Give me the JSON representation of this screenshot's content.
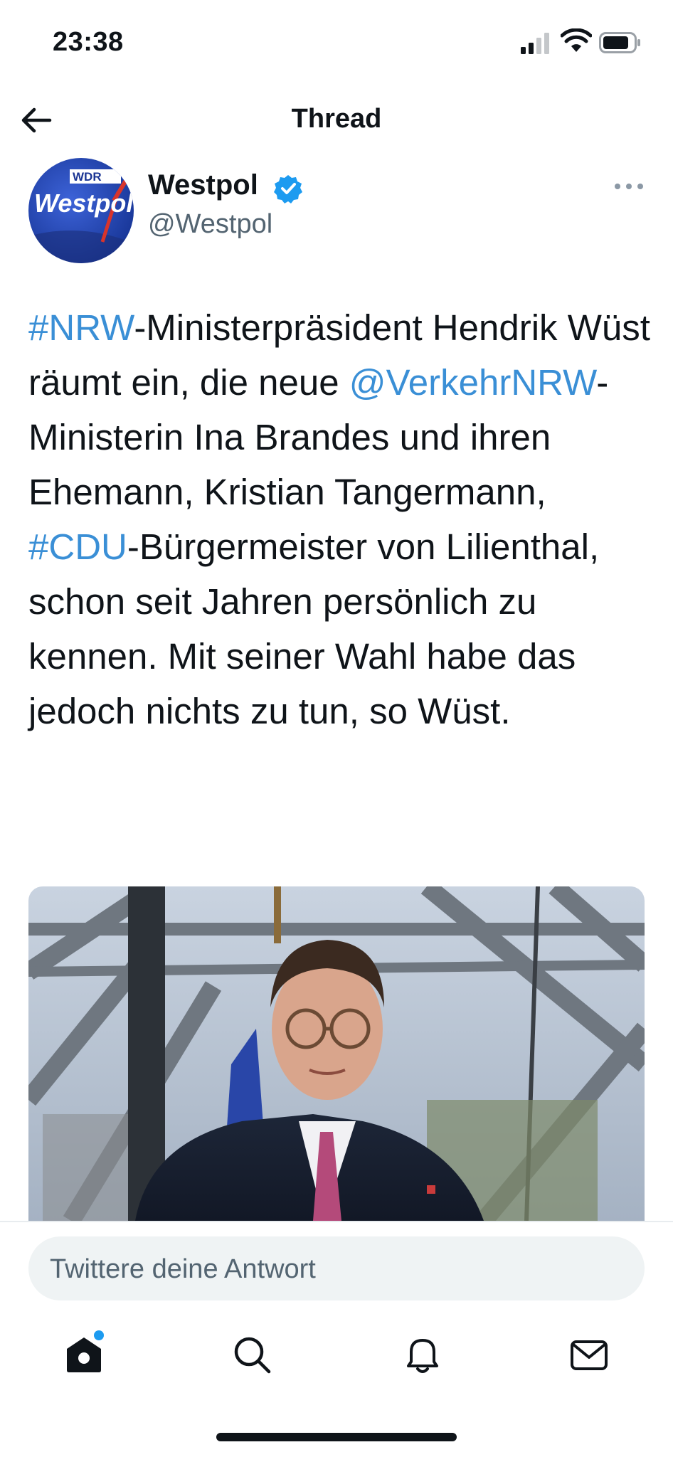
{
  "status_bar": {
    "time": "23:38"
  },
  "header": {
    "title": "Thread"
  },
  "tweet": {
    "author_name": "Westpol",
    "handle": "@Westpol",
    "avatar_text_top": "WDR",
    "avatar_text_main": "Westpol",
    "text": {
      "hashtag_nrw": "#NRW",
      "part1": "-Ministerpräsident Hendrik Wüst räumt ein, die neue ",
      "mention": "@VerkehrNRW",
      "part2": "-Ministerin Ina Brandes und ihren Ehemann, Kristian Tangermann, ",
      "hashtag_cdu": "#CDU",
      "part3": "-Bürgermeister von Lilienthal, schon seit Jahren persönlich zu kennen. Mit seiner Wahl habe das jedoch nichts zu tun, so Wüst."
    }
  },
  "reply": {
    "placeholder": "Twittere deine Antwort"
  },
  "colors": {
    "link": "#3a8fd6",
    "verified": "#1d9bf0",
    "text": "#0f1419",
    "muted": "#536471"
  },
  "icons": [
    "back-arrow-icon",
    "verified-badge-icon",
    "more-dots-icon",
    "home-icon",
    "search-icon",
    "notifications-bell-icon",
    "messages-mail-icon"
  ]
}
